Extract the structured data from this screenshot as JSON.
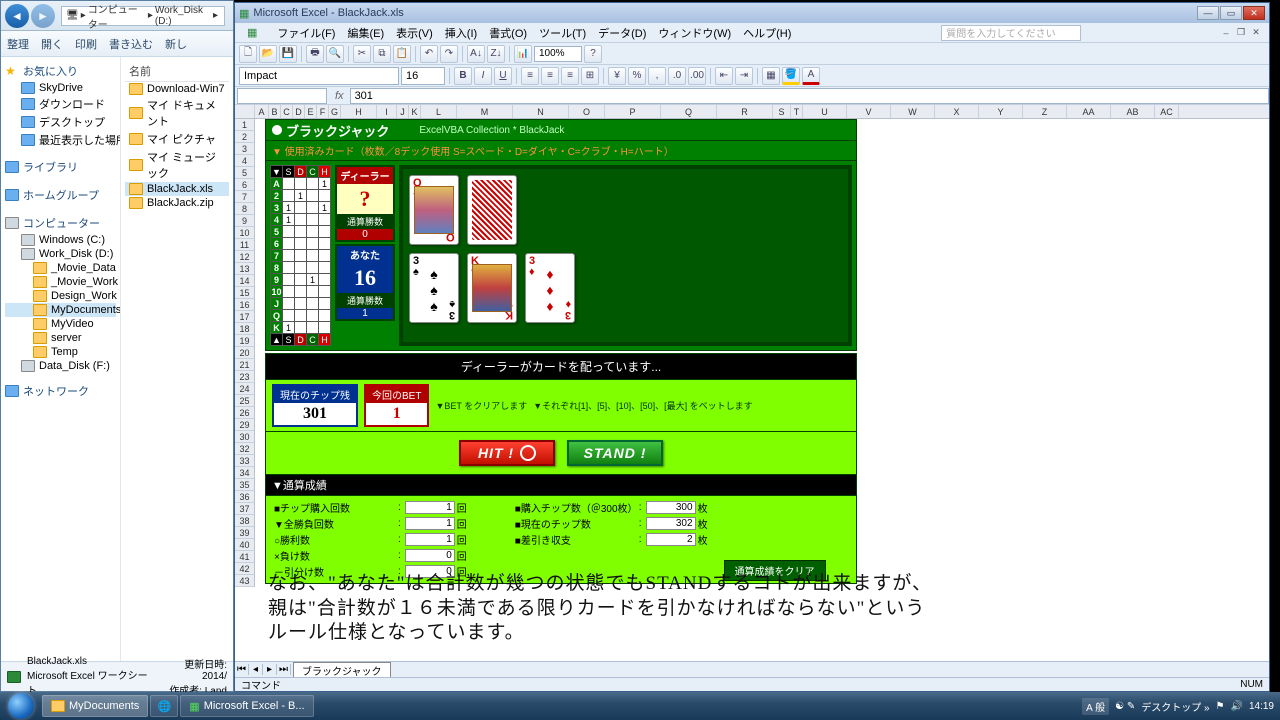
{
  "explorer": {
    "crumbs": [
      "コンピューター",
      "Work_Disk (D:)"
    ],
    "toolbar": {
      "organize": "整理",
      "open": "開く",
      "print": "印刷",
      "burn": "書き込む",
      "new": "新し"
    },
    "favorites": {
      "hdr": "お気に入り",
      "items": [
        "SkyDrive",
        "ダウンロード",
        "デスクトップ",
        "最近表示した場所"
      ]
    },
    "library": "ライブラリ",
    "homegroup": "ホームグループ",
    "computer": {
      "hdr": "コンピューター",
      "items": [
        "Windows (C:)",
        "Work_Disk (D:)",
        "_Movie_Data",
        "_Movie_Work",
        "Design_Work",
        "MyDocuments",
        "MyVideo",
        "server",
        "Temp",
        "Data_Disk (F:)"
      ]
    },
    "network": "ネットワーク",
    "file_hdr": "名前",
    "files": [
      "Download-Win7",
      "マイ ドキュメント",
      "マイ ピクチャ",
      "マイ ミュージック",
      "BlackJack.xls",
      "BlackJack.zip"
    ],
    "status": {
      "name": "BlackJack.xls",
      "type": "Microsoft Excel ワークシート",
      "mod": "更新日時: 2014/",
      "author": "作成者: Land"
    }
  },
  "excel": {
    "title": "Microsoft Excel - BlackJack.xls",
    "menu": [
      "ファイル(F)",
      "編集(E)",
      "表示(V)",
      "挿入(I)",
      "書式(O)",
      "ツール(T)",
      "データ(D)",
      "ウィンドウ(W)",
      "ヘルプ(H)"
    ],
    "help_hint": "質問を入力してください",
    "font": "Impact",
    "size": "16",
    "zoom": "100%",
    "formula": "301",
    "cols": [
      "A",
      "B",
      "C",
      "D",
      "E",
      "F",
      "G",
      "H",
      "I",
      "J",
      "K",
      "L",
      "M",
      "N",
      "O",
      "P",
      "Q",
      "R",
      "S",
      "T",
      "U",
      "V",
      "W",
      "X",
      "Y",
      "Z",
      "AA",
      "AB",
      "AC"
    ],
    "rows": [
      "1",
      "2",
      "3",
      "4",
      "5",
      "6",
      "7",
      "8",
      "9",
      "10",
      "11",
      "12",
      "13",
      "14",
      "15",
      "16",
      "17",
      "18",
      "19",
      "20",
      "21",
      "23",
      "24",
      "25",
      "26",
      "29",
      "30",
      "32",
      "33",
      "34",
      "35",
      "36",
      "37",
      "38",
      "39",
      "40",
      "41",
      "42",
      "43"
    ],
    "tab": "ブラックジャック",
    "status": {
      "ready": "コマンド",
      "num": "NUM"
    }
  },
  "game": {
    "title": "ブラックジャック",
    "subtitle": "ExcelVBA Collection * BlackJack",
    "used_hdr": "▼ 使用済みカード（枚数／8デック使用 S=スペード・D=ダイヤ・C=クラブ・H=ハート）",
    "suits": [
      "S",
      "D",
      "C",
      "H"
    ],
    "ranks": [
      "A",
      "2",
      "3",
      "4",
      "5",
      "6",
      "7",
      "8",
      "9",
      "10",
      "J",
      "Q",
      "K"
    ],
    "used": [
      [
        0,
        0,
        0,
        1
      ],
      [
        0,
        1,
        0,
        0
      ],
      [
        1,
        0,
        0,
        1
      ],
      [
        1,
        0,
        0,
        0
      ],
      [
        0,
        0,
        0,
        0
      ],
      [
        0,
        0,
        0,
        0
      ],
      [
        0,
        0,
        0,
        0
      ],
      [
        0,
        0,
        0,
        0
      ],
      [
        0,
        0,
        1,
        0
      ],
      [
        0,
        0,
        0,
        0
      ],
      [
        0,
        0,
        0,
        0
      ],
      [
        0,
        0,
        0,
        0
      ],
      [
        1,
        0,
        0,
        0
      ]
    ],
    "dealer": {
      "lbl": "ディーラー",
      "val": "?",
      "wins_lbl": "通算勝数",
      "wins": "0"
    },
    "player": {
      "lbl": "あなた",
      "val": "16",
      "wins_lbl": "通算勝数",
      "wins": "1"
    },
    "dealer_cards": [
      {
        "rank": "Q",
        "suit": "♦",
        "red": true
      }
    ],
    "player_cards": [
      {
        "rank": "3",
        "suit": "♠",
        "red": false
      },
      {
        "rank": "K",
        "suit": "♥",
        "red": true,
        "face": true
      },
      {
        "rank": "3",
        "suit": "♦",
        "red": true
      }
    ],
    "status": "ディーラーがカードを配っています...",
    "chips": {
      "lbl": "現在のチップ残",
      "val": "301"
    },
    "bet": {
      "lbl": "今回のBET",
      "val": "1"
    },
    "bet_hint1": "▼BET をクリアします",
    "bet_hint2": "▼それぞれ[1]、[5]、[10]、[50]、[最大] をベットします",
    "hit": "HIT !",
    "stand": "STAND !",
    "results_hdr": "▼通算成績",
    "left_rows": [
      {
        "l": "■チップ購入回数",
        "v": "1",
        "u": "回"
      },
      {
        "l": "▼全勝負回数",
        "v": "1",
        "u": "回"
      },
      {
        "l": "○勝利数",
        "v": "1",
        "u": "回"
      },
      {
        "l": "×負け数",
        "v": "0",
        "u": "回"
      },
      {
        "l": "－引分け数",
        "v": "0",
        "u": "回"
      }
    ],
    "right_rows": [
      {
        "l": "■購入チップ数（＠300枚）",
        "v": "300",
        "u": "枚"
      },
      {
        "l": "■現在のチップ数",
        "v": "302",
        "u": "枚"
      },
      {
        "l": "■差引き収支",
        "v": "2",
        "u": "枚"
      }
    ],
    "clear": "通算成績をクリア"
  },
  "overlay": "なお、\"あなた\"は合計数が幾つの状態でもSTANDするコトが出来ますが、\n親は\"合計数が１６未満である限りカードを引かなければならない\"という\nルール仕様となっています。",
  "taskbar": {
    "tasks": [
      "MyDocuments",
      "",
      "Microsoft Excel - B..."
    ],
    "lang": "A 般",
    "tray2": "デスクトップ »",
    "time": "14:19"
  }
}
